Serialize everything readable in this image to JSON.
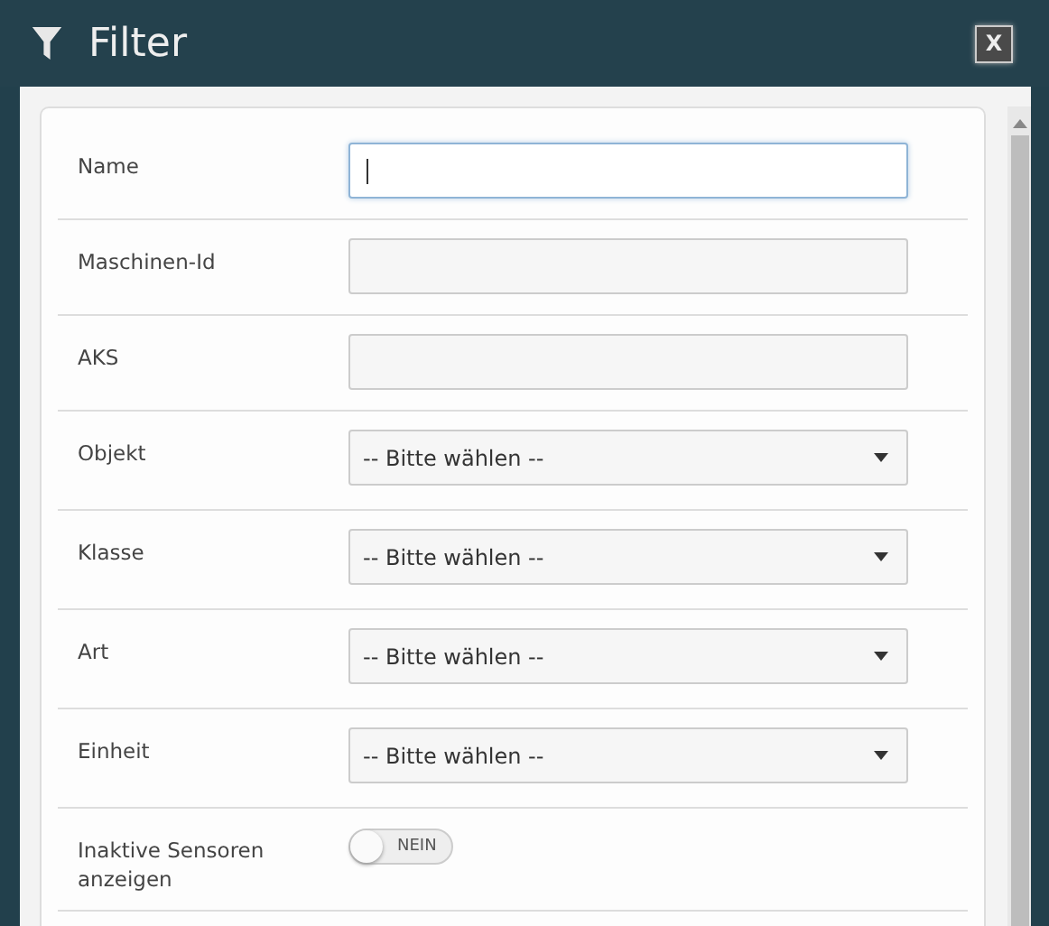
{
  "window": {
    "title": "Filter",
    "close_label": "X"
  },
  "fields": [
    {
      "kind": "text",
      "label": "Name",
      "disabled": false
    },
    {
      "kind": "text",
      "label": "Maschinen-Id",
      "disabled": true
    },
    {
      "kind": "text",
      "label": "AKS",
      "disabled": true
    },
    {
      "kind": "select",
      "label": "Objekt",
      "value": "-- Bitte wählen --"
    },
    {
      "kind": "select",
      "label": "Klasse",
      "value": "-- Bitte wählen --"
    },
    {
      "kind": "select",
      "label": "Art",
      "value": "-- Bitte wählen --"
    },
    {
      "kind": "select",
      "label": "Einheit",
      "value": "-- Bitte wählen --"
    },
    {
      "kind": "toggle",
      "label": "Inaktive Sensoren anzeigen",
      "on": false,
      "state_label": "NEIN"
    }
  ]
}
